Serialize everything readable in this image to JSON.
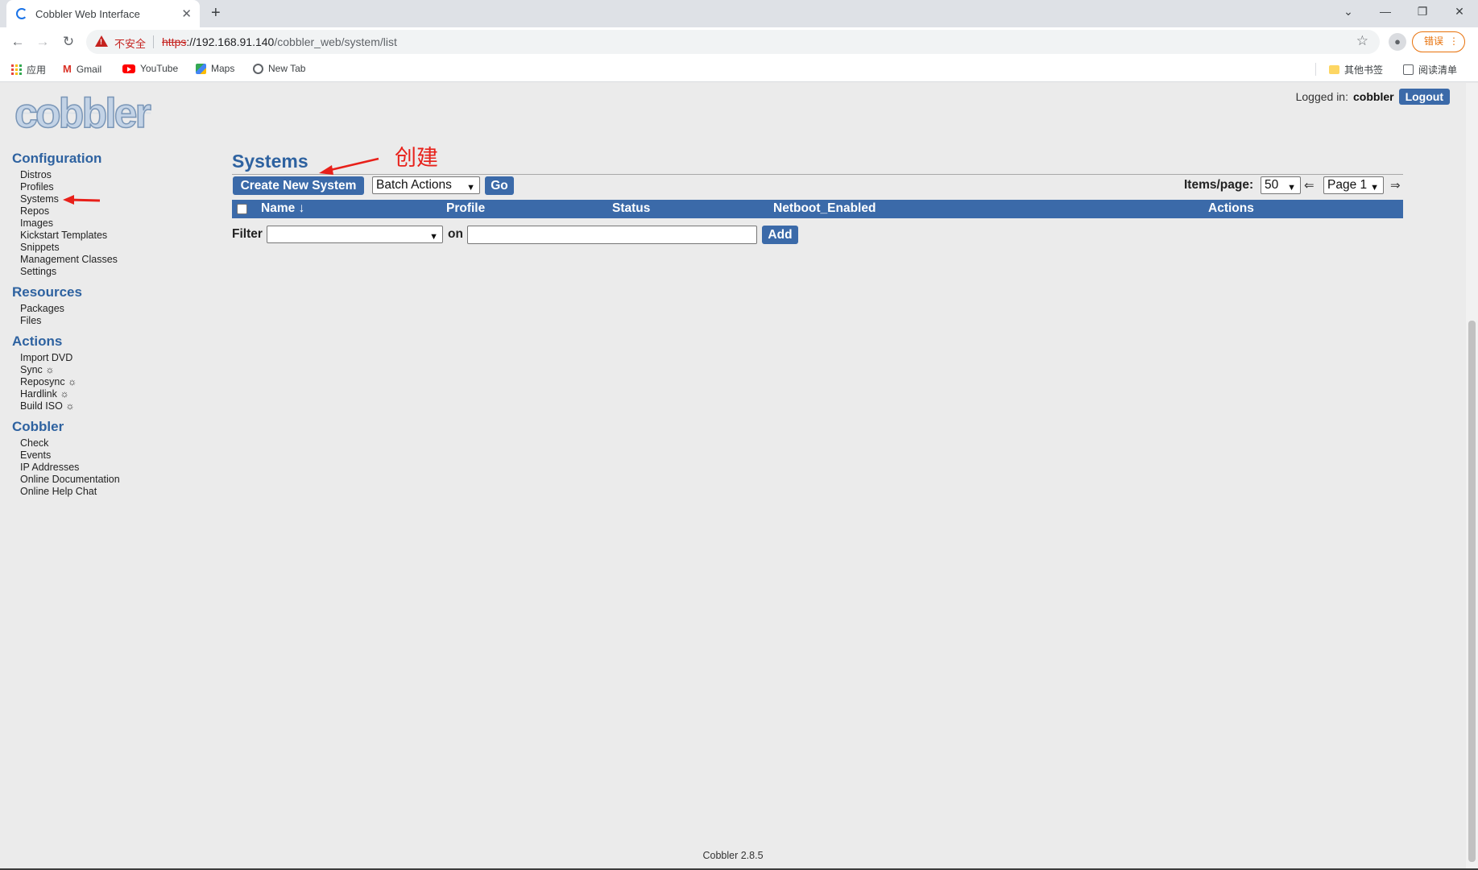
{
  "browser": {
    "tab_title": "Cobbler Web Interface",
    "new_tab_symbol": "+",
    "window_controls": [
      "⌄",
      "—",
      "❐",
      "✕"
    ],
    "security_label": "不安全",
    "url_scheme": "https",
    "url_host": "://192.168.91.140",
    "url_path": "/cobbler_web/system/list",
    "error_label": "错误",
    "bookmarks": {
      "apps": "应用",
      "gmail": "Gmail",
      "youtube": "YouTube",
      "maps": "Maps",
      "newtab": "New Tab",
      "other": "其他书签",
      "reading": "阅读清单"
    }
  },
  "header": {
    "logo": "cobbler",
    "logged_in_label": "Logged in:",
    "username": "cobbler",
    "logout_label": "Logout"
  },
  "sidebar": {
    "configuration": {
      "title": "Configuration",
      "items": [
        "Distros",
        "Profiles",
        "Systems",
        "Repos",
        "Images",
        "Kickstart Templates",
        "Snippets",
        "Management Classes",
        "Settings"
      ]
    },
    "resources": {
      "title": "Resources",
      "items": [
        "Packages",
        "Files"
      ]
    },
    "actions": {
      "title": "Actions",
      "items": [
        "Import DVD",
        "Sync ☼",
        "Reposync ☼",
        "Hardlink ☼",
        "Build ISO ☼"
      ]
    },
    "cobbler": {
      "title": "Cobbler",
      "items": [
        "Check",
        "Events",
        "IP Addresses",
        "Online Documentation",
        "Online Help Chat"
      ]
    }
  },
  "main": {
    "title": "Systems",
    "create_button": "Create New System",
    "batch_actions": "Batch Actions",
    "go_button": "Go",
    "items_per_page_label": "Items/page:",
    "items_per_page_value": "50",
    "prev_arrow": "⇐",
    "page_value": "Page 1",
    "next_arrow": "⇒",
    "columns": [
      "Name ↓",
      "Profile",
      "Status",
      "Netboot_Enabled",
      "Actions"
    ],
    "filter_label": "Filter",
    "on_label": "on",
    "filter_value": "",
    "add_button": "Add"
  },
  "annotation": {
    "text": "创建",
    "color": "#e8201a"
  },
  "footer": {
    "version": "Cobbler 2.8.5"
  },
  "colors": {
    "accent": "#3b6aa9",
    "heading": "#2e62a0",
    "page_bg": "#ebebeb"
  }
}
